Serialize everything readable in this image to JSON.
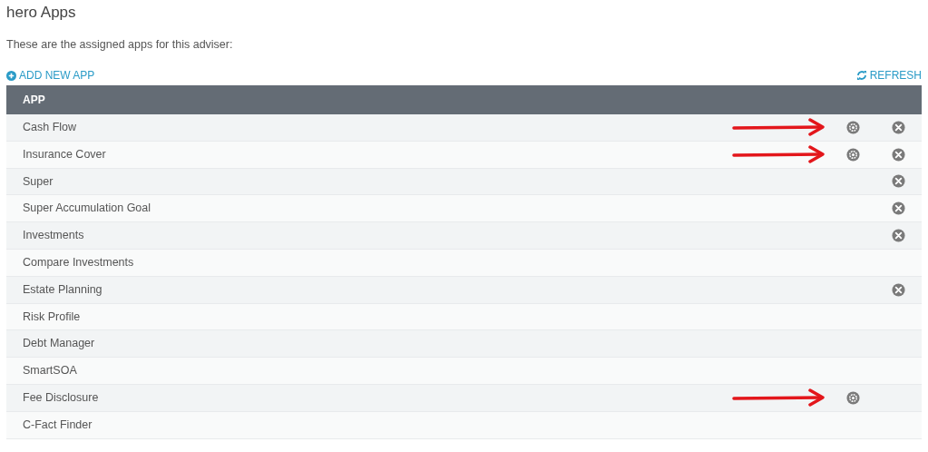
{
  "page": {
    "title": "hero Apps",
    "subtitle": "These are the assigned apps for this adviser:"
  },
  "toolbar": {
    "add_label": "ADD NEW APP",
    "refresh_label": "REFRESH"
  },
  "table": {
    "columns": [
      "APP"
    ],
    "rows": [
      {
        "name": "Cash Flow",
        "settings": true,
        "remove": true,
        "annotated": true
      },
      {
        "name": "Insurance Cover",
        "settings": true,
        "remove": true,
        "annotated": true
      },
      {
        "name": "Super",
        "settings": false,
        "remove": true,
        "annotated": false
      },
      {
        "name": "Super Accumulation Goal",
        "settings": false,
        "remove": true,
        "annotated": false
      },
      {
        "name": "Investments",
        "settings": false,
        "remove": true,
        "annotated": false
      },
      {
        "name": "Compare Investments",
        "settings": false,
        "remove": false,
        "annotated": false
      },
      {
        "name": "Estate Planning",
        "settings": false,
        "remove": true,
        "annotated": false
      },
      {
        "name": "Risk Profile",
        "settings": false,
        "remove": false,
        "annotated": false
      },
      {
        "name": "Debt Manager",
        "settings": false,
        "remove": false,
        "annotated": false
      },
      {
        "name": "SmartSOA",
        "settings": false,
        "remove": false,
        "annotated": false
      },
      {
        "name": "Fee Disclosure",
        "settings": true,
        "remove": false,
        "annotated": true
      },
      {
        "name": "C-Fact Finder",
        "settings": false,
        "remove": false,
        "annotated": false
      }
    ]
  }
}
